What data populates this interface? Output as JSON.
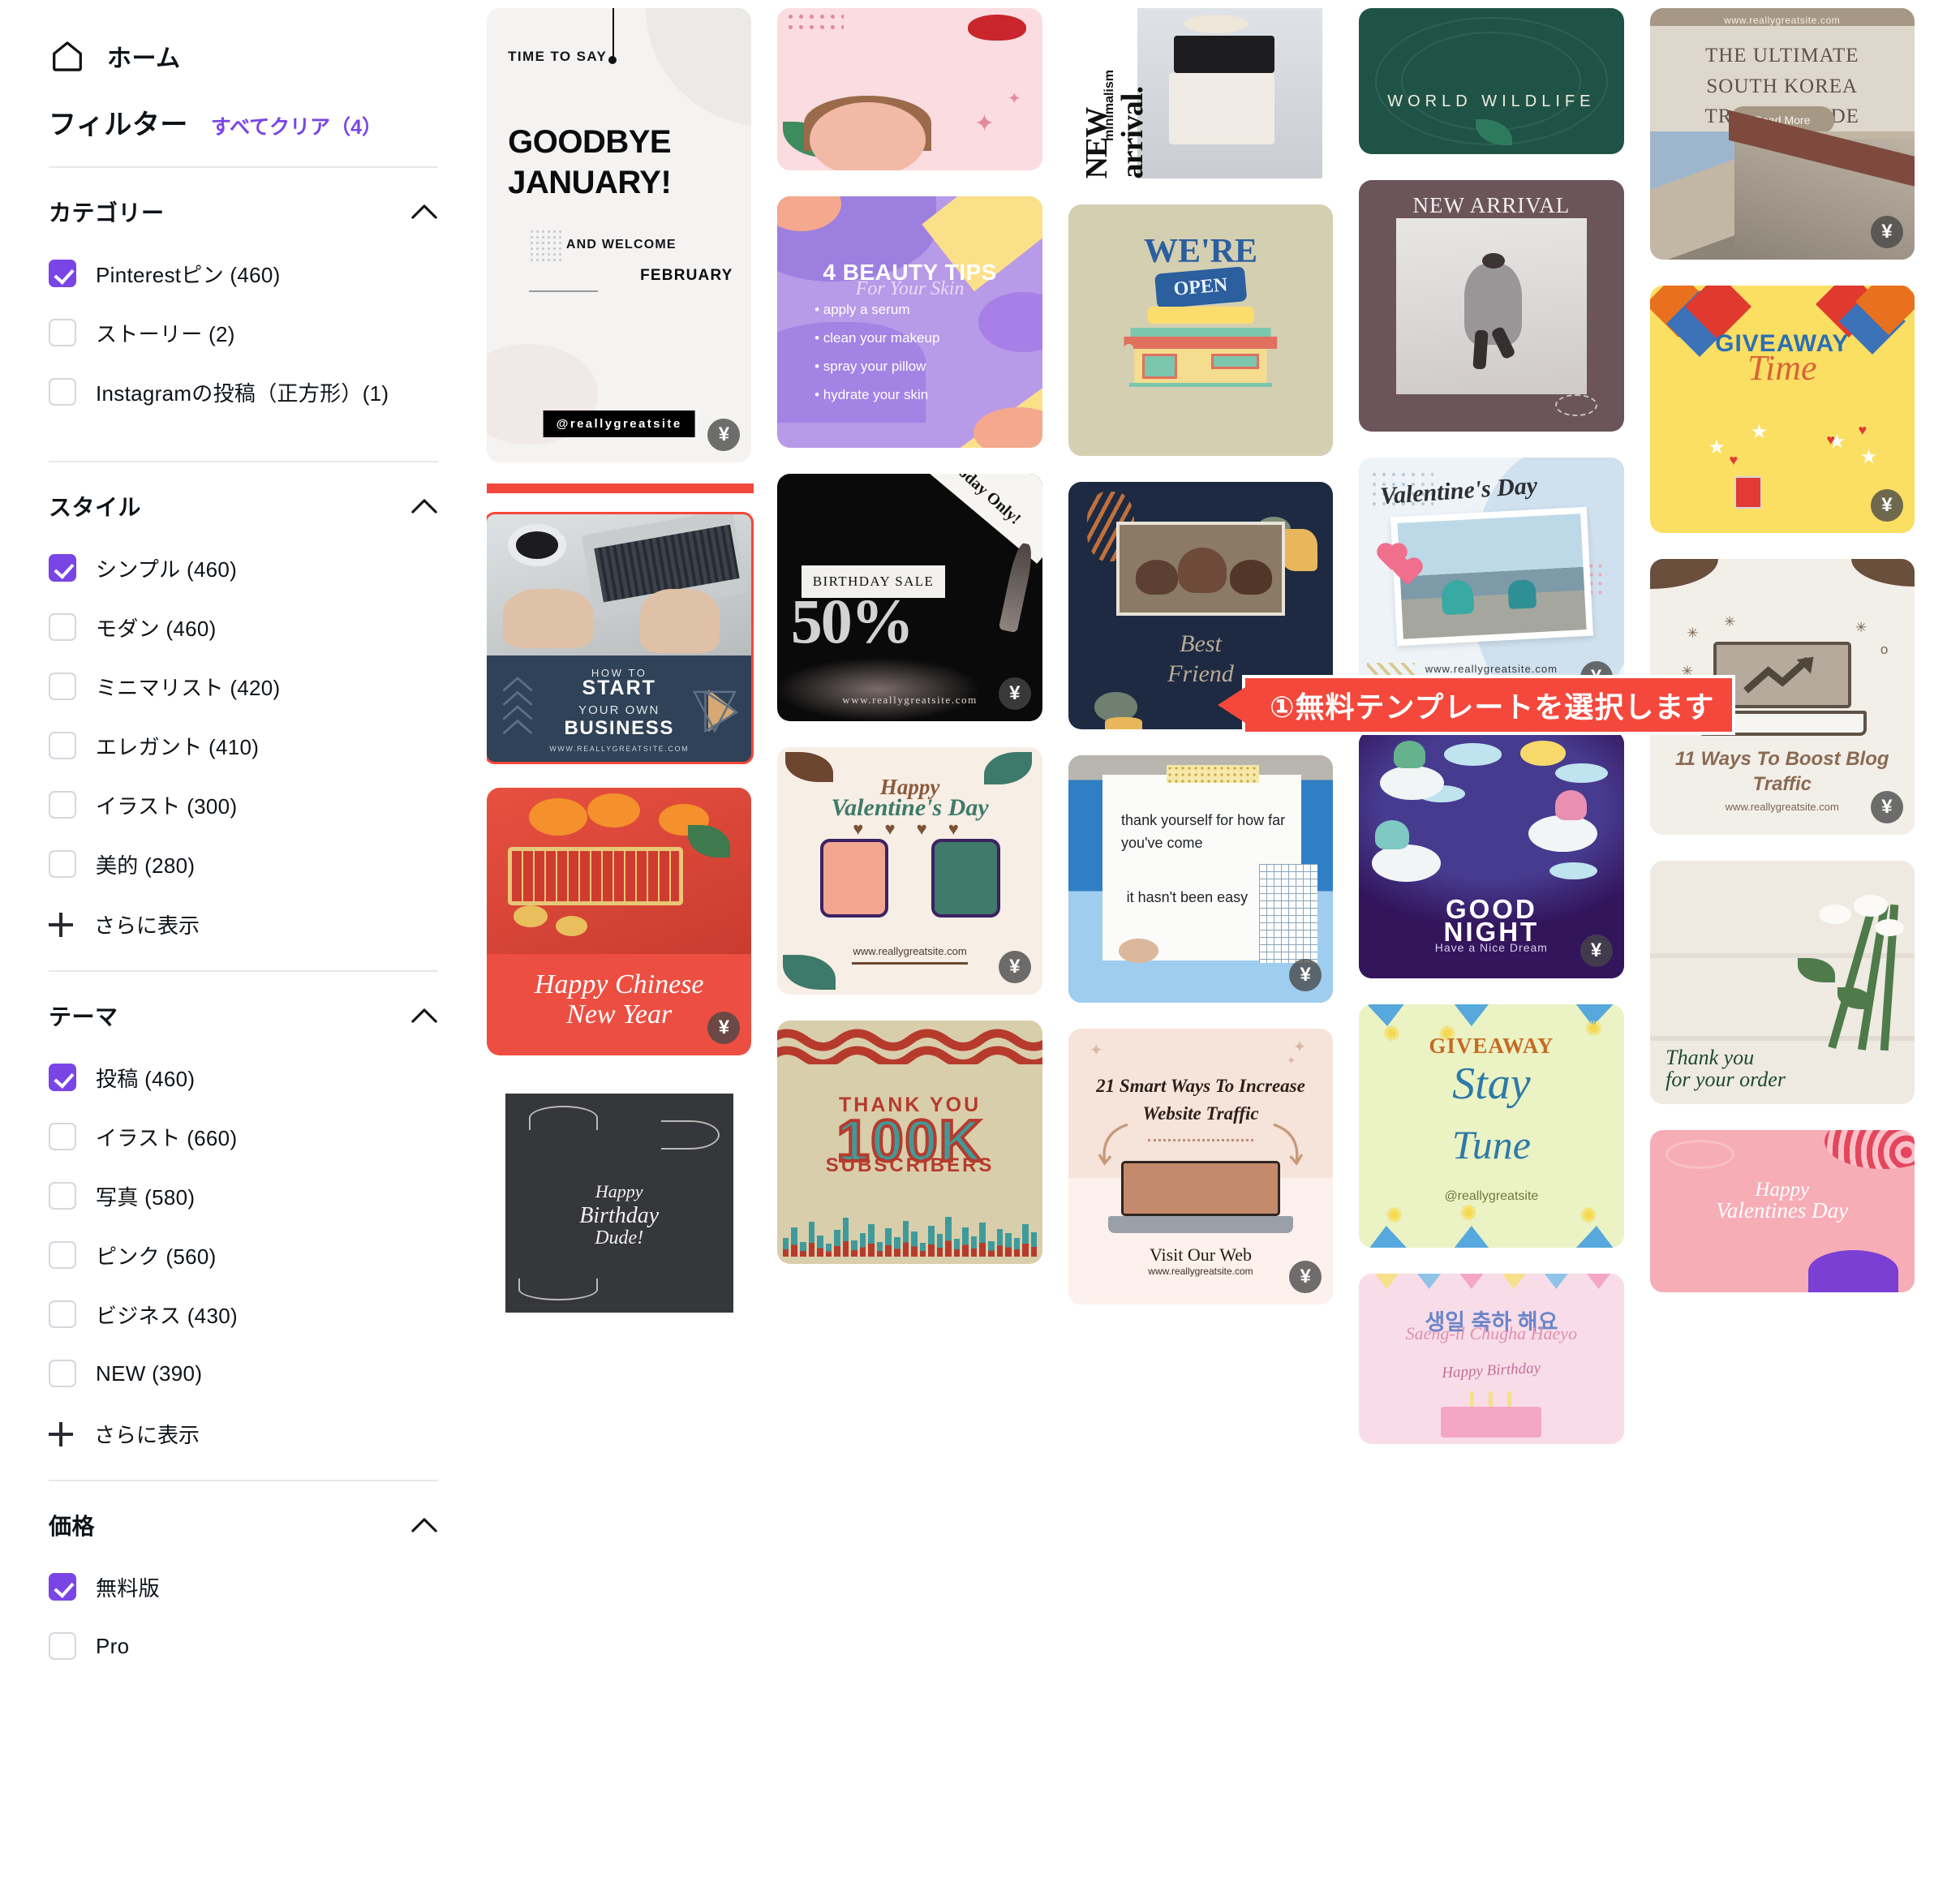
{
  "sidebar": {
    "home": {
      "label": "ホーム",
      "icon": "home-icon"
    },
    "filters_title": "フィルター",
    "clear_all": "すべてクリア（4）",
    "show_more_label": "さらに表示",
    "accent_color": "#7a45e5",
    "sections": [
      {
        "title": "カテゴリー",
        "collapse_icon": "chevron-up-icon",
        "has_show_more": false,
        "options": [
          {
            "label": "Pinterestピン (460)",
            "checked": true
          },
          {
            "label": "ストーリー (2)",
            "checked": false
          },
          {
            "label": "Instagramの投稿（正方形）(1)",
            "checked": false
          }
        ]
      },
      {
        "title": "スタイル",
        "collapse_icon": "chevron-up-icon",
        "has_show_more": true,
        "options": [
          {
            "label": "シンプル (460)",
            "checked": true
          },
          {
            "label": "モダン (460)",
            "checked": false
          },
          {
            "label": "ミニマリスト (420)",
            "checked": false
          },
          {
            "label": "エレガント (410)",
            "checked": false
          },
          {
            "label": "イラスト (300)",
            "checked": false
          },
          {
            "label": "美的 (280)",
            "checked": false
          }
        ]
      },
      {
        "title": "テーマ",
        "collapse_icon": "chevron-up-icon",
        "has_show_more": true,
        "options": [
          {
            "label": "投稿 (460)",
            "checked": true
          },
          {
            "label": "イラスト (660)",
            "checked": false
          },
          {
            "label": "写真 (580)",
            "checked": false
          },
          {
            "label": "ピンク (560)",
            "checked": false
          },
          {
            "label": "ビジネス (430)",
            "checked": false
          },
          {
            "label": "NEW (390)",
            "checked": false
          }
        ]
      },
      {
        "title": "価格",
        "collapse_icon": "chevron-up-icon",
        "has_show_more": false,
        "options": [
          {
            "label": "無料版",
            "checked": true
          },
          {
            "label": "Pro",
            "checked": false
          }
        ]
      }
    ]
  },
  "annotation": {
    "text": "①無料テンプレートを選択します",
    "color": "#f4483c"
  },
  "grid": {
    "pro_badge": "¥",
    "selected_card": "how-to-start-your-own-business",
    "cards": [
      {
        "id": "goodbye-january",
        "texts": {
          "eyebrow": "TIME TO SAY",
          "line1": "GOODBYE",
          "line2": "JANUARY!",
          "small": "AND WELCOME",
          "month": "FEBRUARY",
          "handle": "@reallygreatsite"
        },
        "pro": true
      },
      {
        "id": "how-to-start-your-own-business",
        "texts": {
          "l1": "HOW TO",
          "l2": "START",
          "l3": "YOUR OWN",
          "l4": "BUSINESS",
          "url": "WWW.REALLYGREATSITE.COM"
        },
        "pro": false,
        "selected": true
      },
      {
        "id": "happy-chinese-new-year",
        "texts": {
          "l1": "Happy Chinese",
          "l2": "New Year"
        },
        "pro": true
      },
      {
        "id": "happy-birthday-dude",
        "texts": {
          "l1": "Happy",
          "l2": "Birthday",
          "l3": "Dude!"
        },
        "pro": false
      },
      {
        "id": "pink-girl-sparkle",
        "texts": {},
        "pro": false
      },
      {
        "id": "4-beauty-tips",
        "texts": {
          "title": "4 BEAUTY TIPS",
          "subtitle": "For Your Skin",
          "items": [
            "apply a serum",
            "clean your makeup",
            "spray your pillow",
            "hydrate your skin"
          ]
        },
        "pro": false
      },
      {
        "id": "birthday-sale-50",
        "texts": {
          "corner": "Today Only!",
          "label": "BIRTHDAY SALE",
          "big": "50%",
          "url": "www.reallygreatsite.com"
        },
        "pro": true
      },
      {
        "id": "happy-valentines-day-phones",
        "texts": {
          "l1": "Happy",
          "l2": "Valentine's Day",
          "hearts": "♥ ♥ ♥ ♥",
          "url": "www.reallygreatsite.com"
        },
        "pro": true
      },
      {
        "id": "thank-you-100k-subscribers",
        "texts": {
          "l1": "THANK YOU",
          "l2": "100K",
          "l3": "SUBSCRIBERS"
        },
        "pro": false
      },
      {
        "id": "new-arrival-minimalism",
        "texts": {
          "title": "NEW arrival.",
          "sub": "minimalism"
        },
        "pro": false
      },
      {
        "id": "best-friend-photo",
        "texts": {
          "l1": "Best",
          "l2": "Friend"
        },
        "pro": true
      },
      {
        "id": "thank-yourself-note",
        "texts": {
          "l1": "thank yourself for how far you've come",
          "l2": "it hasn't been easy"
        },
        "pro": true
      },
      {
        "id": "21-smart-ways-website-traffic",
        "texts": {
          "title": "21 Smart Ways To Increase Website Traffic",
          "cta": "Visit Our Web",
          "url": "www.reallygreatsite.com"
        },
        "pro": true
      },
      {
        "id": "world-wildlife-day",
        "texts": {
          "l1": "WORLD WILDLIFE"
        },
        "pro": false
      },
      {
        "id": "valentines-day-bicycle",
        "texts": {
          "title": "Valentine's Day",
          "url": "www.reallygreatsite.com"
        },
        "pro": true
      },
      {
        "id": "good-night-sheep",
        "texts": {
          "l1": "GOOD",
          "l2": "NIGHT",
          "l3": "Have a Nice Dream"
        },
        "pro": true
      },
      {
        "id": "giveaway-stay-tune",
        "texts": {
          "l1": "GIVEAWAY",
          "l2": "Stay",
          "l3": "Tune",
          "handle": "@reallygreatsite"
        },
        "pro": false
      },
      {
        "id": "saeng-il-chugha-haeyo",
        "texts": {
          "l1": "생일 축하 해요",
          "l2": "Saeng-il Chugha Haeyo",
          "l3": "Happy Birthday"
        },
        "pro": false
      },
      {
        "id": "giveaway-time",
        "texts": {
          "l1": "GIVEAWAY",
          "l2": "Time"
        },
        "pro": true
      },
      {
        "id": "11-ways-boost-blog-traffic",
        "texts": {
          "title": "11 Ways To Boost Blog Traffic",
          "url": "www.reallygreatsite.com"
        },
        "pro": true
      },
      {
        "id": "thank-you-for-your-order",
        "texts": {
          "l1": "Thank you",
          "l2": "for your order"
        },
        "pro": false
      },
      {
        "id": "happy-valentines-day-pink",
        "texts": {
          "l1": "Happy",
          "l2": "Valentines Day"
        },
        "pro": false
      },
      {
        "id": "new-arrival-backpack",
        "texts": {
          "title": "NEW ARRIVAL"
        },
        "pro": false
      },
      {
        "id": "were-open-shop",
        "texts": {
          "l1": "WE'RE",
          "l2": "OPEN"
        },
        "pro": false
      },
      {
        "id": "ultimate-south-korea-travel-guide",
        "texts": {
          "bar": "www.reallygreatsite.com",
          "l1": "THE ULTIMATE",
          "l2": "SOUTH KOREA",
          "l3": "TRAVEL GUIDE",
          "btn": "Read More"
        },
        "pro": true
      }
    ]
  }
}
